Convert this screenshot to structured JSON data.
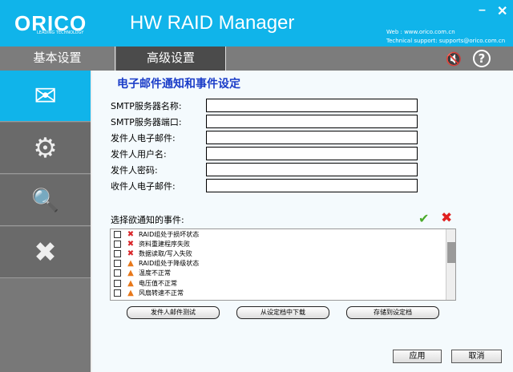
{
  "header": {
    "brand": "ORICO",
    "brand_tagline": "LEADING TECHNOLOGY",
    "title": "HW RAID Manager",
    "web": "Web : www.orico.com.cn",
    "support": "Technical support: supports@orico.com.cn",
    "minimize": "–",
    "close": "✕"
  },
  "tabs": [
    {
      "label": "基本设置"
    },
    {
      "label": "高级设置"
    }
  ],
  "toolbar": {
    "mute_icon": "🔇",
    "help_icon": "?"
  },
  "sidebar": {
    "items": [
      {
        "icon": "mail-icon",
        "glyph": "✉"
      },
      {
        "icon": "disk-settings-icon",
        "glyph": "⚙"
      },
      {
        "icon": "report-search-icon",
        "glyph": "🔍"
      },
      {
        "icon": "tools-icon",
        "glyph": "✖"
      }
    ]
  },
  "main": {
    "heading": "电子邮件通知和事件设定",
    "fields": [
      {
        "label": "SMTP服务器名称:",
        "value": ""
      },
      {
        "label": "SMTP服务器端口:",
        "value": ""
      },
      {
        "label": "发件人电子邮件:",
        "value": ""
      },
      {
        "label": "发件人用户名:",
        "value": ""
      },
      {
        "label": "发件人密码:",
        "value": ""
      },
      {
        "label": "收件人电子邮件:",
        "value": ""
      }
    ],
    "events_label": "选择欲通知的事件:",
    "select_all": "✔",
    "deselect_all": "✖",
    "events": [
      {
        "type": "error",
        "label": "RAID组处于损坏状态"
      },
      {
        "type": "error",
        "label": "资料重建程序失败"
      },
      {
        "type": "error",
        "label": "数据读取/写入失败"
      },
      {
        "type": "warning",
        "label": "RAID组处于降级状态"
      },
      {
        "type": "warning",
        "label": "温度不正常"
      },
      {
        "type": "warning",
        "label": "电压值不正常"
      },
      {
        "type": "warning",
        "label": "风扇转速不正常"
      }
    ],
    "buttons": {
      "test": "发件人邮件测试",
      "load": "从设定档中下载",
      "save": "存储到设定档",
      "apply": "应用",
      "cancel": "取消"
    }
  }
}
